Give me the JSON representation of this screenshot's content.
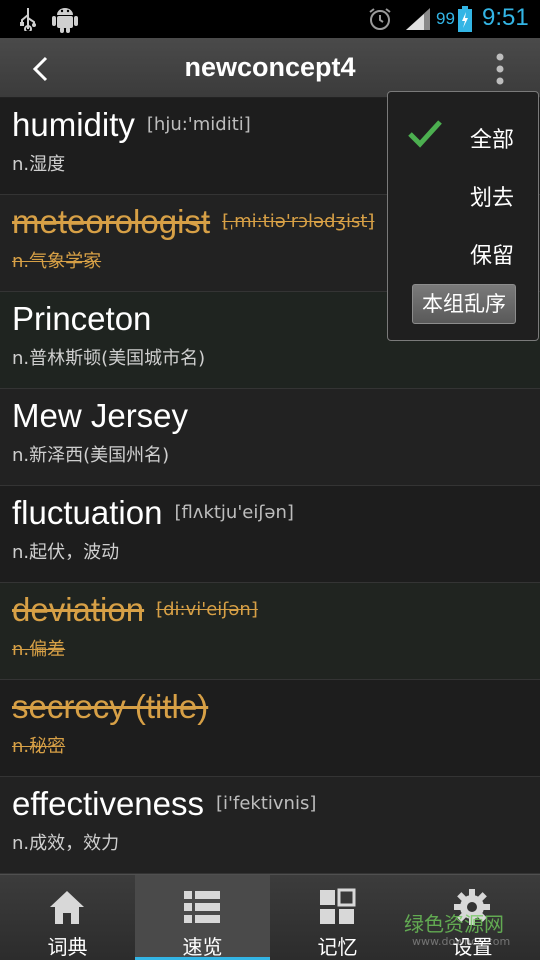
{
  "status_bar": {
    "battery_percent": "99",
    "time": "9:51",
    "icons": [
      "usb-icon",
      "android-debug-icon",
      "alarm-icon",
      "signal-icon",
      "battery-icon"
    ]
  },
  "action_bar": {
    "title": "newconcept4",
    "back_icon": "chevron-left-icon",
    "overflow_icon": "overflow-menu-icon"
  },
  "words": [
    {
      "word": "humidity",
      "phonetic": "[hju:'miditi]",
      "meaning": "n.湿度",
      "crossed": false
    },
    {
      "word": "meteorologist",
      "phonetic": "[ˌmi:tiə'rɔlədʒist]",
      "meaning": "n.气象学家",
      "crossed": true
    },
    {
      "word": "Princeton",
      "phonetic": "",
      "meaning": "n.普林斯顿(美国城市名)",
      "crossed": false
    },
    {
      "word": "Mew Jersey",
      "phonetic": "",
      "meaning": "n.新泽西(美国州名)",
      "crossed": false
    },
    {
      "word": "fluctuation",
      "phonetic": "[flʌktju'eiʃən]",
      "meaning": "n.起伏，波动",
      "crossed": false
    },
    {
      "word": "deviation",
      "phonetic": "[di:vi'eiʃən]",
      "meaning": "n.偏差",
      "crossed": true
    },
    {
      "word": "secrecy (title)",
      "phonetic": "",
      "meaning": "n.秘密",
      "crossed": true
    },
    {
      "word": "effectiveness",
      "phonetic": "[i'fektivnis]",
      "meaning": "n.成效，效力",
      "crossed": false
    }
  ],
  "popup_menu": {
    "items": [
      "全部",
      "划去",
      "保留"
    ],
    "selected": "全部",
    "shuffle_button": "本组乱序"
  },
  "tabs": [
    {
      "label": "词典",
      "icon": "home-icon",
      "active": false
    },
    {
      "label": "速览",
      "icon": "list-icon",
      "active": true
    },
    {
      "label": "记忆",
      "icon": "grid-icon",
      "active": false
    },
    {
      "label": "设置",
      "icon": "gear-icon",
      "active": false
    }
  ],
  "watermark": {
    "text": "绿色资源网",
    "url": "www.downcc.com"
  },
  "colors": {
    "accent": "#33b5e5",
    "crossed_word": "#d7a046",
    "check": "#4caf50"
  }
}
